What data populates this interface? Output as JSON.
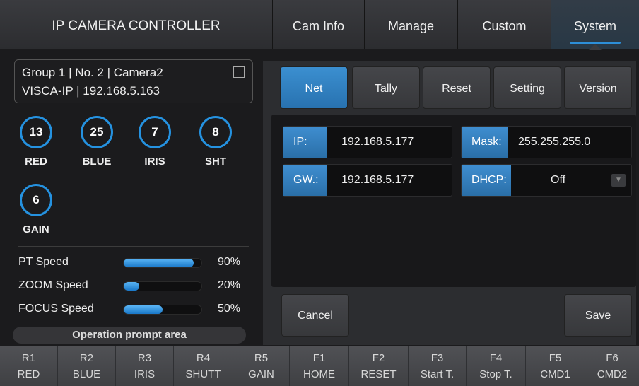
{
  "header": {
    "title": "IP CAMERA CONTROLLER",
    "tabs": [
      {
        "label": "Cam Info"
      },
      {
        "label": "Manage"
      },
      {
        "label": "Custom"
      },
      {
        "label": "System",
        "active": true
      }
    ]
  },
  "camera": {
    "line1": "Group 1 | No. 2 | Camera2",
    "line2": "VISCA-IP | 192.168.5.163",
    "checked": false
  },
  "params": [
    {
      "value": "13",
      "label": "RED"
    },
    {
      "value": "25",
      "label": "BLUE"
    },
    {
      "value": "7",
      "label": "IRIS"
    },
    {
      "value": "8",
      "label": "SHT"
    },
    {
      "value": "6",
      "label": "GAIN"
    }
  ],
  "speeds": [
    {
      "label": "PT Speed",
      "percent": 90,
      "value": "90%"
    },
    {
      "label": "ZOOM Speed",
      "percent": 20,
      "value": "20%"
    },
    {
      "label": "FOCUS Speed",
      "percent": 50,
      "value": "50%"
    }
  ],
  "prompt": "Operation prompt area",
  "system": {
    "subtabs": [
      {
        "label": "Net",
        "active": true
      },
      {
        "label": "Tally"
      },
      {
        "label": "Reset"
      },
      {
        "label": "Setting"
      },
      {
        "label": "Version"
      }
    ],
    "net": {
      "ip_label": "IP:",
      "ip": "192.168.5.177",
      "mask_label": "Mask:",
      "mask": "255.255.255.0",
      "gw_label": "GW.:",
      "gw": "192.168.5.177",
      "dhcp_label": "DHCP:",
      "dhcp": "Off"
    },
    "cancel": "Cancel",
    "save": "Save"
  },
  "fkeys": [
    {
      "key": "R1",
      "name": "RED"
    },
    {
      "key": "R2",
      "name": "BLUE"
    },
    {
      "key": "R3",
      "name": "IRIS"
    },
    {
      "key": "R4",
      "name": "SHUTT"
    },
    {
      "key": "R5",
      "name": "GAIN"
    },
    {
      "key": "F1",
      "name": "HOME"
    },
    {
      "key": "F2",
      "name": "RESET"
    },
    {
      "key": "F3",
      "name": "Start T."
    },
    {
      "key": "F4",
      "name": "Stop T."
    },
    {
      "key": "F5",
      "name": "CMD1"
    },
    {
      "key": "F6",
      "name": "CMD2"
    }
  ],
  "colors": {
    "accent": "#2592e0",
    "background": "#1b1b1d",
    "panel": "#2c2d30"
  }
}
